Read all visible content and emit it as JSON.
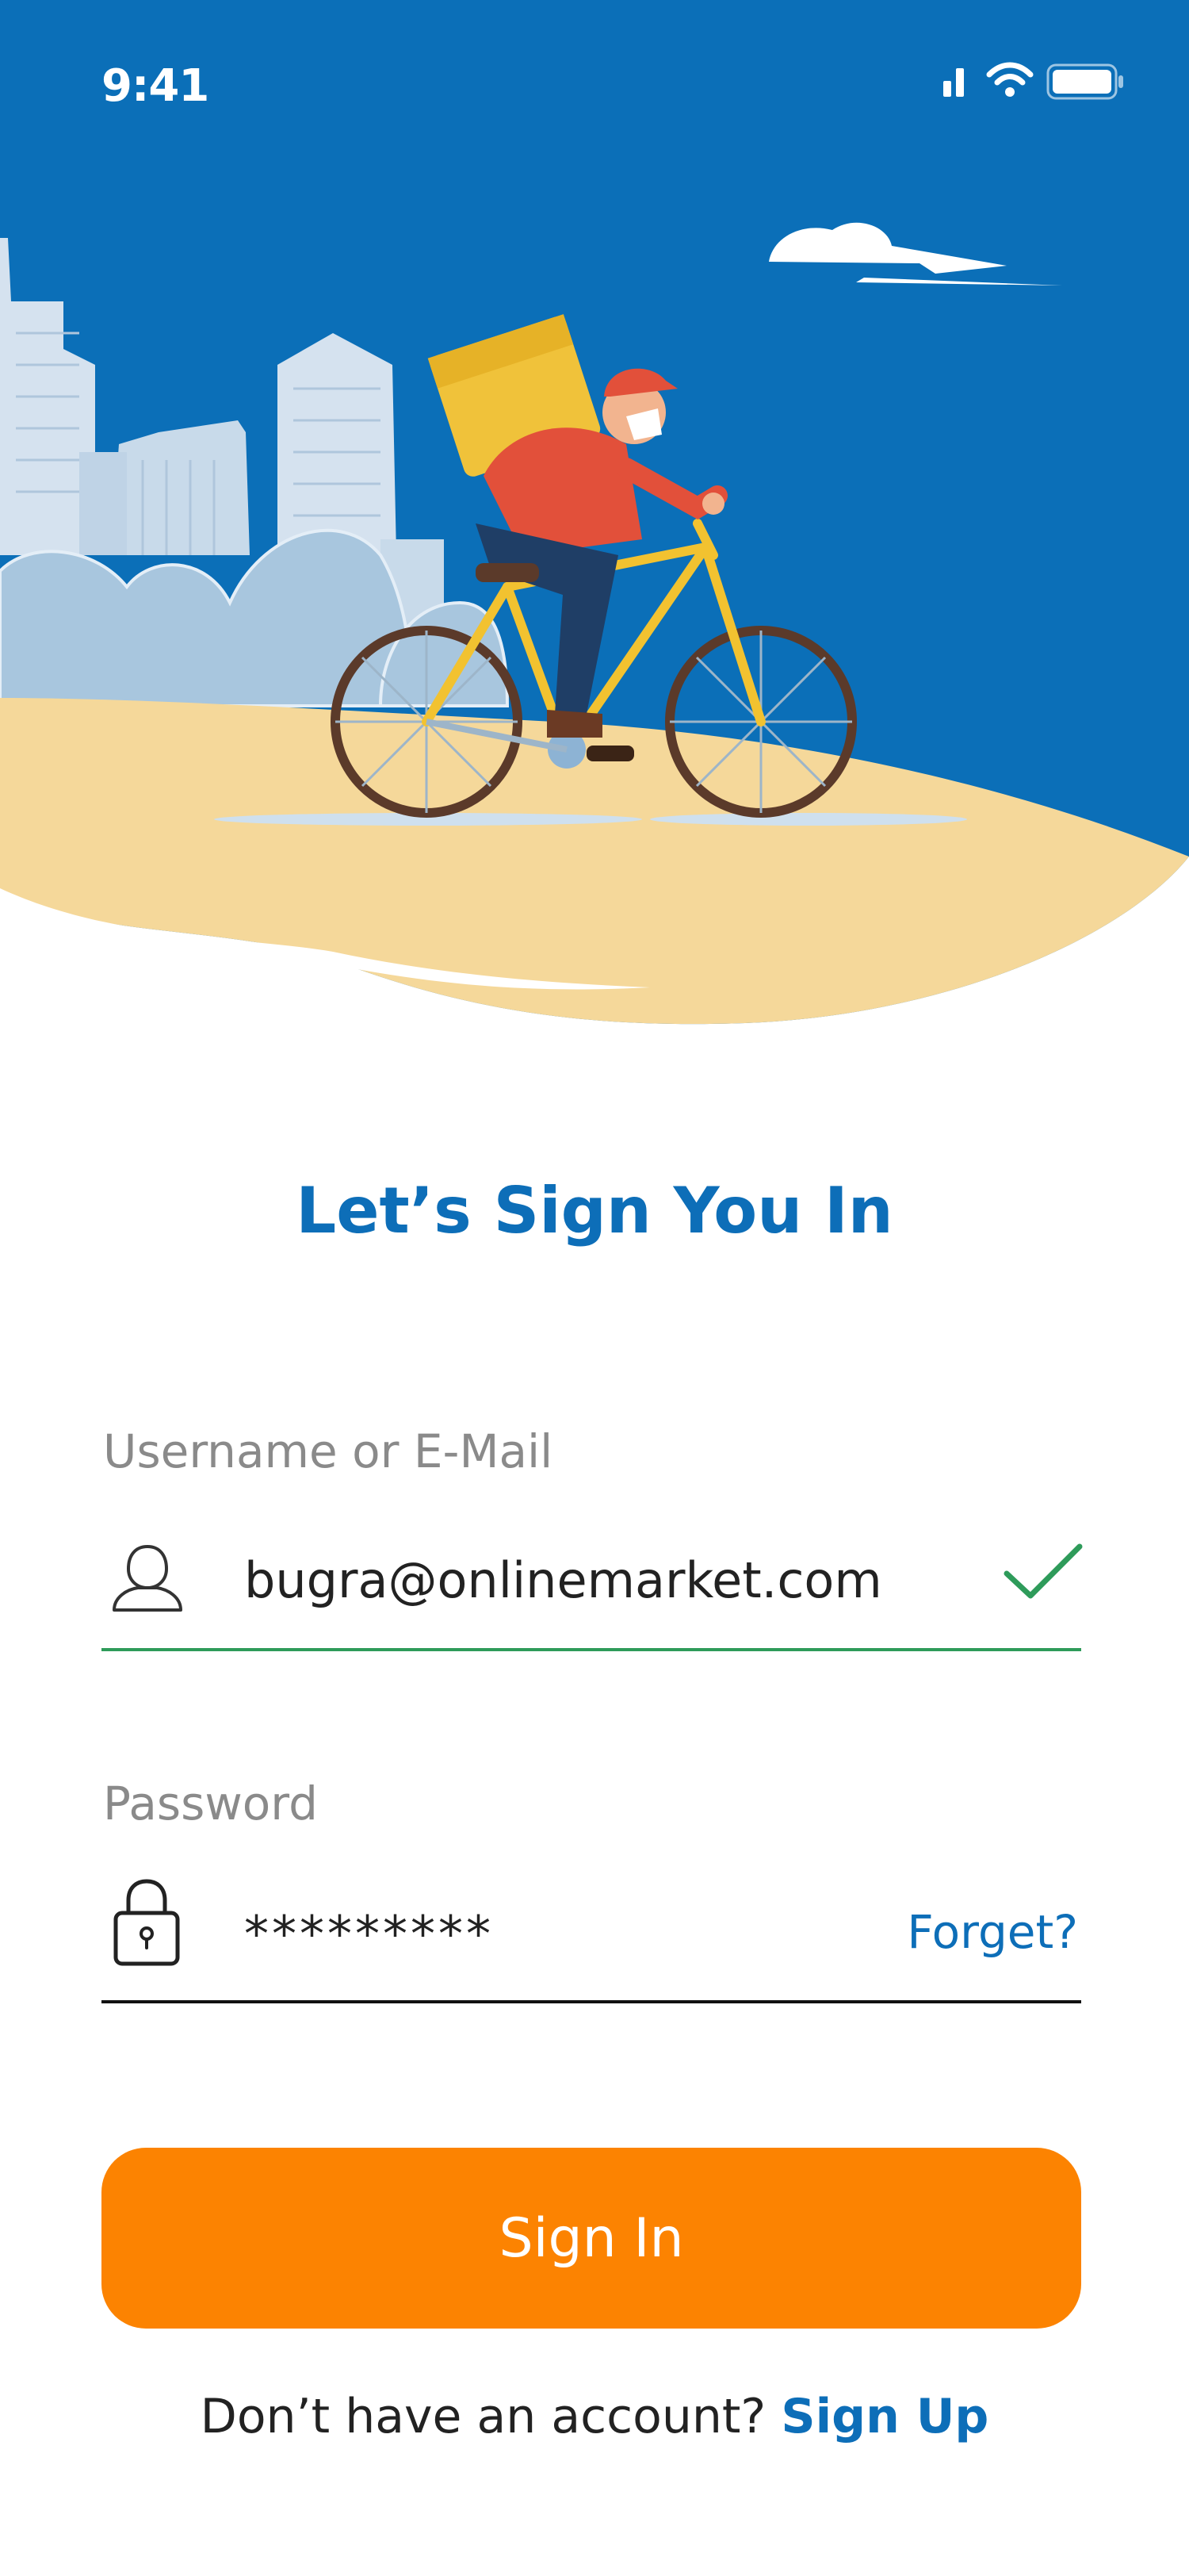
{
  "status_bar": {
    "time": "9:41"
  },
  "title": "Let’s Sign You In",
  "username": {
    "label": "Username or E-Mail",
    "value": "bugra@onlinemarket.com"
  },
  "password": {
    "label": "Password",
    "value": "*********",
    "forget_label": "Forget?"
  },
  "signin_button": "Sign In",
  "footer": {
    "prompt": "Don’t have an account?",
    "signup_label": "Sign Up"
  },
  "colors": {
    "primary_blue": "#0D6EB8",
    "accent_orange": "#FC8301",
    "success_green": "#2E9B5A",
    "sand": "#F5D89A",
    "label_gray": "#8A8A8A"
  },
  "icons": [
    "signal-icon",
    "wifi-icon",
    "battery-icon",
    "user-icon",
    "checkmark-icon",
    "lock-icon"
  ]
}
